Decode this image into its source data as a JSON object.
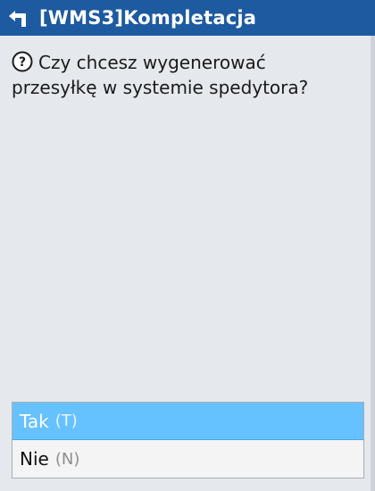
{
  "window": {
    "title": "[WMS3]Kompletacja"
  },
  "question": {
    "line1": "Czy chcesz wygenerować",
    "line2": "przesyłkę w systemie spedytora?"
  },
  "options": [
    {
      "label": "Tak",
      "hotkey": "(T)",
      "selected": true
    },
    {
      "label": "Nie",
      "hotkey": "(N)",
      "selected": false
    }
  ],
  "colors": {
    "titlebar": "#1e5aa0",
    "selected_option": "#66c1ff",
    "background": "#e5e8ed"
  },
  "icons": {
    "back": "back-arrow-icon",
    "question": "question-circle-icon"
  }
}
